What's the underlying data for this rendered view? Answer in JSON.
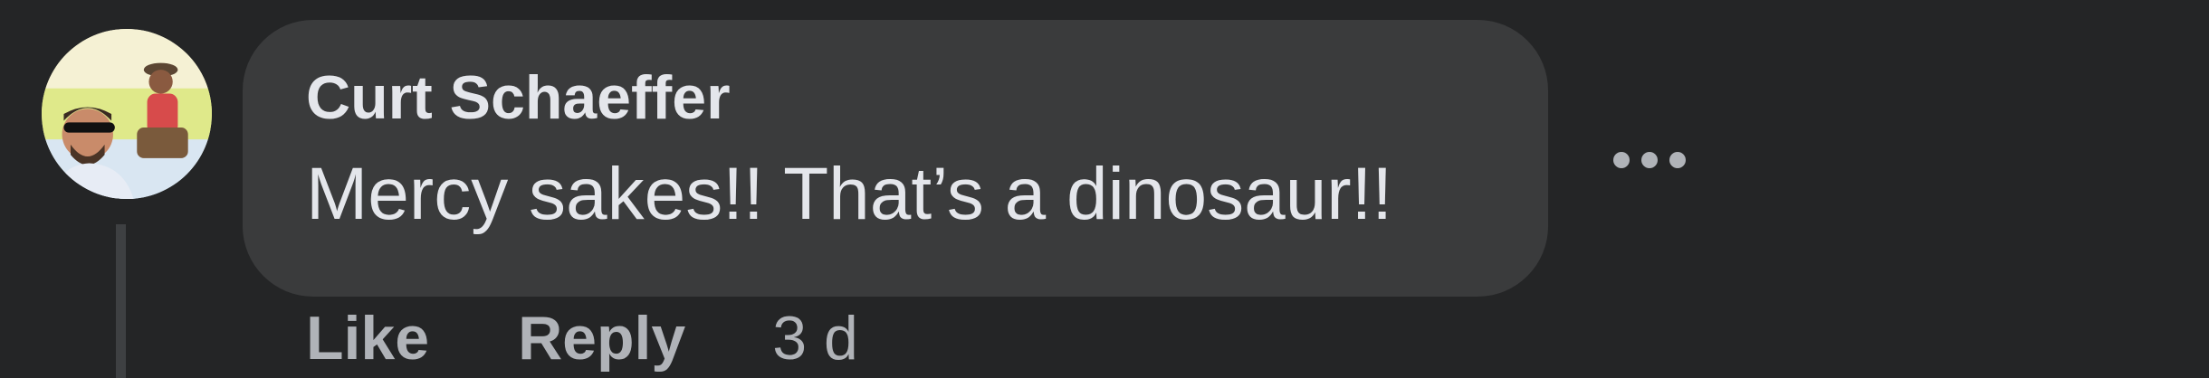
{
  "comment": {
    "author": "Curt Schaeffer",
    "text": "Mercy sakes!! That’s a dinosaur!!",
    "timestamp": "3 d",
    "actions": {
      "like": "Like",
      "reply": "Reply"
    },
    "more_icon": "more-horizontal-icon"
  },
  "colors": {
    "background": "#242526",
    "bubble": "#3a3b3c",
    "primary_text": "#e4e6eb",
    "secondary_text": "#b0b3b8",
    "thread_line": "#3e4042"
  }
}
